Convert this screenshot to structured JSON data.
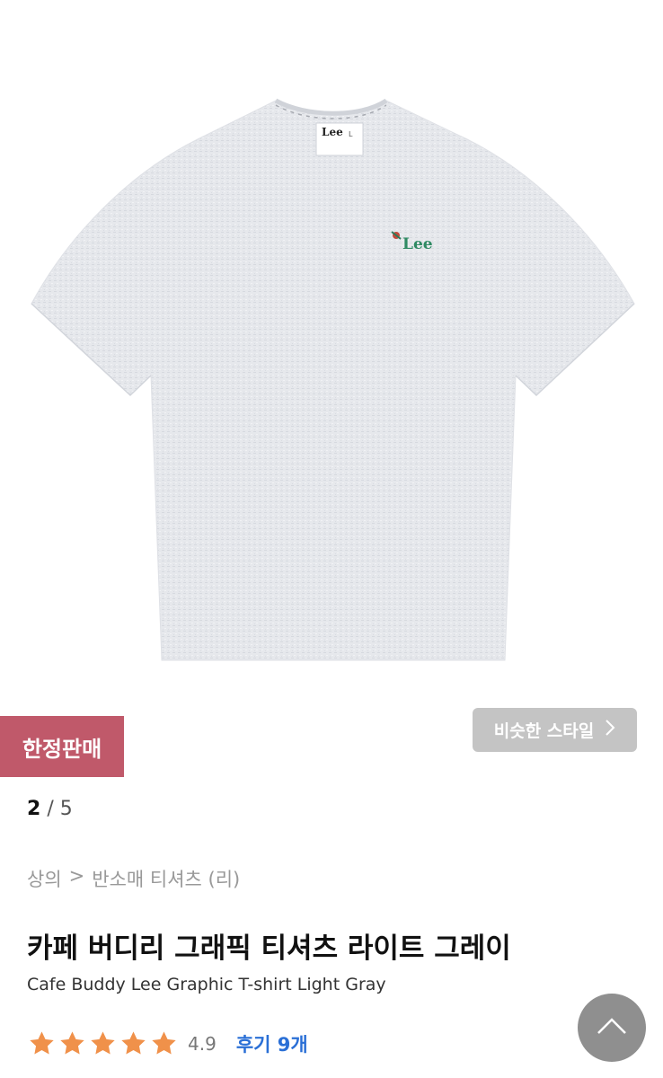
{
  "badge": {
    "label": "한정판매",
    "color": "#c0596a"
  },
  "similar_style": {
    "label": "비슷한 스타일",
    "icon": "chevron-right-icon"
  },
  "pagination": {
    "current": "2",
    "separator": "/",
    "total": "5"
  },
  "breadcrumb": {
    "category": "상의",
    "separator": ">",
    "subcategory": "반소매 티셔츠 (리)"
  },
  "product": {
    "name_ko": "카페 버디리 그래픽 티셔츠 라이트 그레이",
    "name_en": "Cafe Buddy Lee Graphic T-shirt Light Gray",
    "image_logo_text": "Lee",
    "label_brand": "Lee",
    "label_size": "L"
  },
  "rating": {
    "stars": 5,
    "value": "4.9",
    "review_label": "후기 9개",
    "star_color": "#f0914a"
  },
  "scroll_top": {
    "icon": "chevron-up-icon"
  }
}
